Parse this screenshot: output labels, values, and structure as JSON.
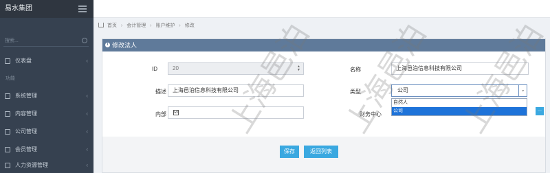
{
  "app": {
    "brand": "易水集团"
  },
  "sidebar": {
    "search_placeholder": "搜索...",
    "items": [
      {
        "label": "仪表盘",
        "icon": "home-icon"
      },
      {
        "label": "功能",
        "icon": "gear-icon"
      },
      {
        "label": "系统管理",
        "icon": "gears-icon"
      },
      {
        "label": "内容管理",
        "icon": "doc-icon"
      },
      {
        "label": "公司管理",
        "icon": "org-icon"
      },
      {
        "label": "会员管理",
        "icon": "trophy-icon"
      },
      {
        "label": "人力资源管理",
        "icon": "user-icon"
      }
    ]
  },
  "breadcrumb": [
    "首页",
    "会计管理",
    "账户维护",
    "修改"
  ],
  "panel": {
    "title": "修改法人"
  },
  "form": {
    "id_label": "ID",
    "id_value": "20",
    "name_label": "名称",
    "name_value": "上海邑泊信息科技有限公司",
    "desc_label": "描述",
    "desc_value": "上海邑泊信息科技有限公司",
    "type_label": "类型",
    "type_value": "公司",
    "type_options": [
      "自然人",
      "公司"
    ],
    "internal_label": "内部",
    "internal_checked": "☑",
    "finance_label": "财务中心",
    "finance_button": "..."
  },
  "actions": {
    "save": "保存",
    "back": "返回列表"
  },
  "watermark": "上海邑泊",
  "colors": {
    "primary": "#3aa8e0",
    "panel_header": "#5f7a9a",
    "sidebar": "#364150",
    "selected": "#1e73d9"
  }
}
